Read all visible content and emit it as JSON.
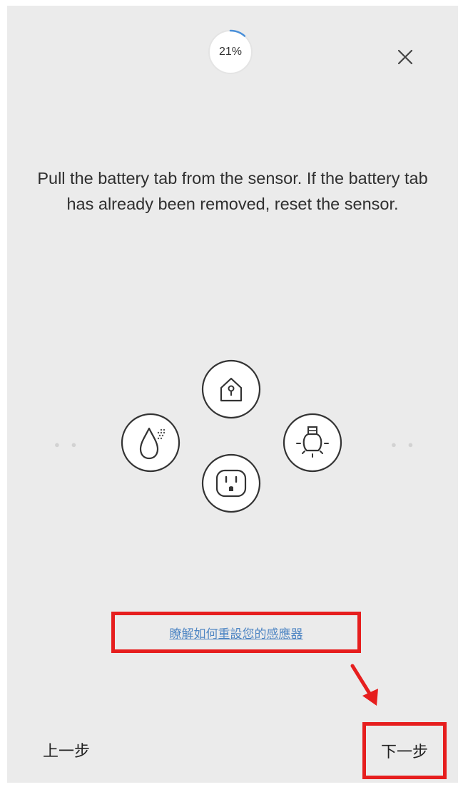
{
  "header": {
    "progress_label": "21%",
    "progress_value": 0.21,
    "close_icon": "close-icon"
  },
  "instruction": {
    "text": "Pull the battery tab from the sensor. If the battery tab has already been removed, reset the sensor."
  },
  "sensors": [
    {
      "icon": "home-sensor-icon"
    },
    {
      "icon": "water-leak-sensor-icon"
    },
    {
      "icon": "light-bulb-sensor-icon"
    },
    {
      "icon": "outlet-sensor-icon"
    }
  ],
  "reset_link": {
    "label": "瞭解如何重設您的感應器"
  },
  "nav": {
    "back_label": "上一步",
    "next_label": "下一步"
  },
  "colors": {
    "background": "#ebebeb",
    "link": "#4f86c3",
    "highlight": "#e61e1e",
    "progress_accent": "#4a90d9"
  }
}
